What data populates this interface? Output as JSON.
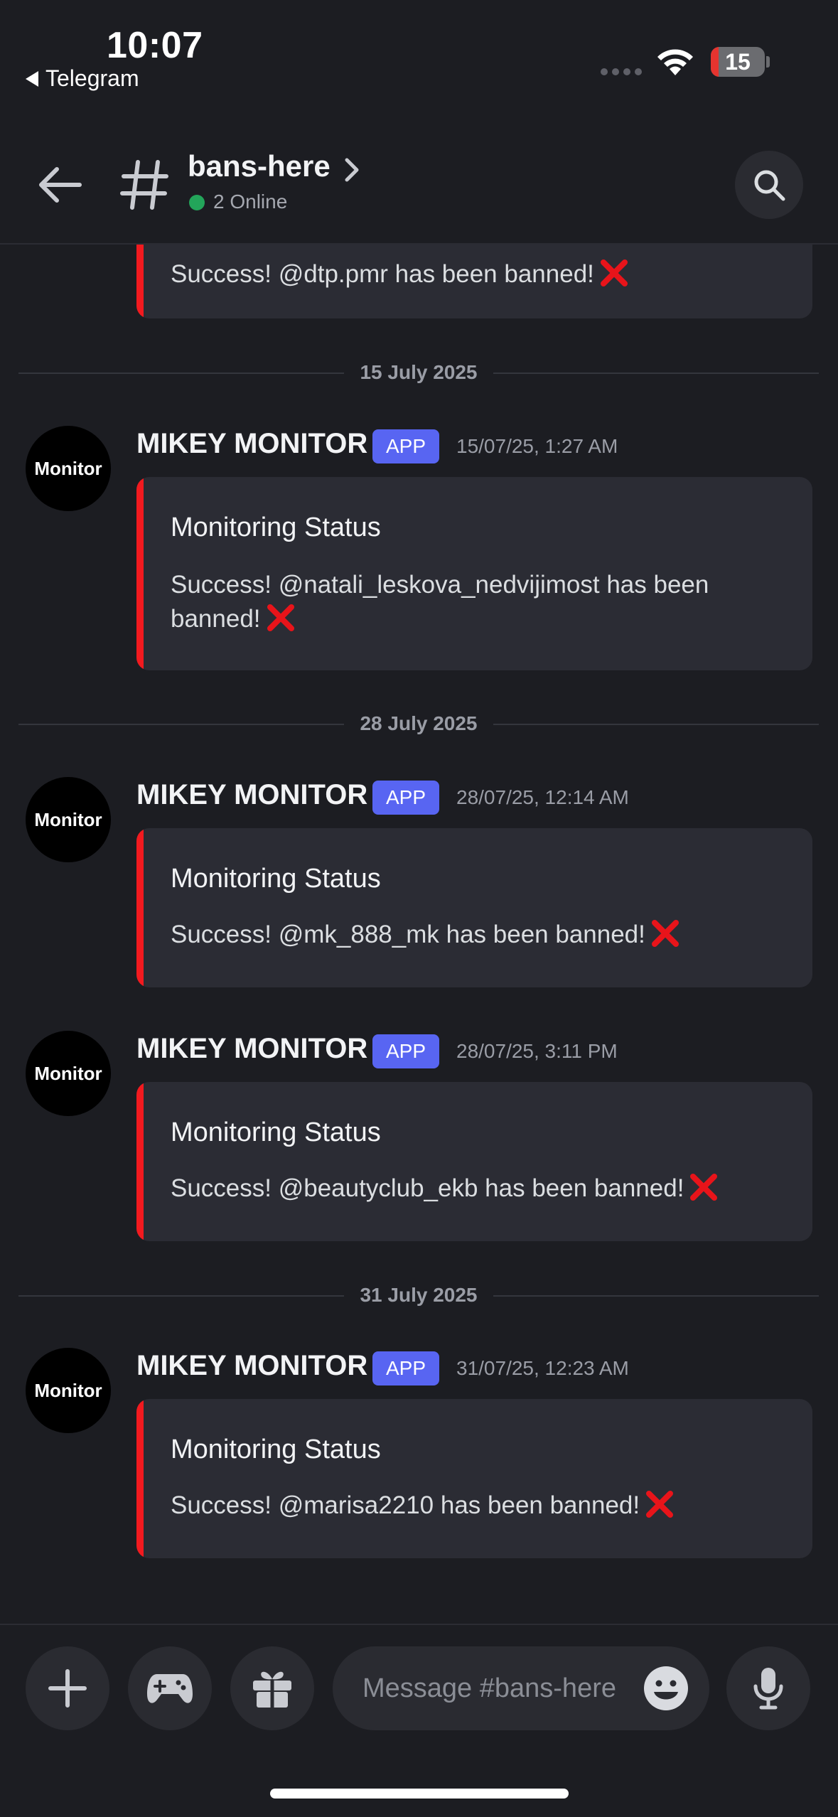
{
  "status_bar": {
    "time": "10:07",
    "back_app": "Telegram",
    "battery_level": "15",
    "battery_fraction": 0.15
  },
  "header": {
    "channel_name": "bans-here",
    "online": "2 Online"
  },
  "messages": {
    "partial": {
      "text": "Success! @dtp.pmr has been banned!"
    },
    "dividers": [
      "15 July 2025",
      "28 July 2025",
      "31 July 2025"
    ],
    "items": [
      {
        "author": "MIKEY MONITOR",
        "badge": "APP",
        "avatar": "Monitor",
        "timestamp": "15/07/25, 1:27 AM",
        "title": "Monitoring Status",
        "text": "Success! @natali_leskova_nedvijimost has been banned!"
      },
      {
        "author": "MIKEY MONITOR",
        "badge": "APP",
        "avatar": "Monitor",
        "timestamp": "28/07/25, 12:14 AM",
        "title": "Monitoring Status",
        "text": "Success! @mk_888_mk has been banned!"
      },
      {
        "author": "MIKEY MONITOR",
        "badge": "APP",
        "avatar": "Monitor",
        "timestamp": "28/07/25, 3:11 PM",
        "title": "Monitoring Status",
        "text": "Success! @beautyclub_ekb has been banned!"
      },
      {
        "author": "MIKEY MONITOR",
        "badge": "APP",
        "avatar": "Monitor",
        "timestamp": "31/07/25, 12:23 AM",
        "title": "Monitoring Status",
        "text": "Success! @marisa2210 has been banned!"
      }
    ]
  },
  "input": {
    "placeholder": "Message #bans-here"
  },
  "colors": {
    "background": "#1c1d22",
    "embed_bg": "#2b2c34",
    "embed_accent": "#f21a1f",
    "app_badge": "#5865f2",
    "online": "#23a55a"
  }
}
